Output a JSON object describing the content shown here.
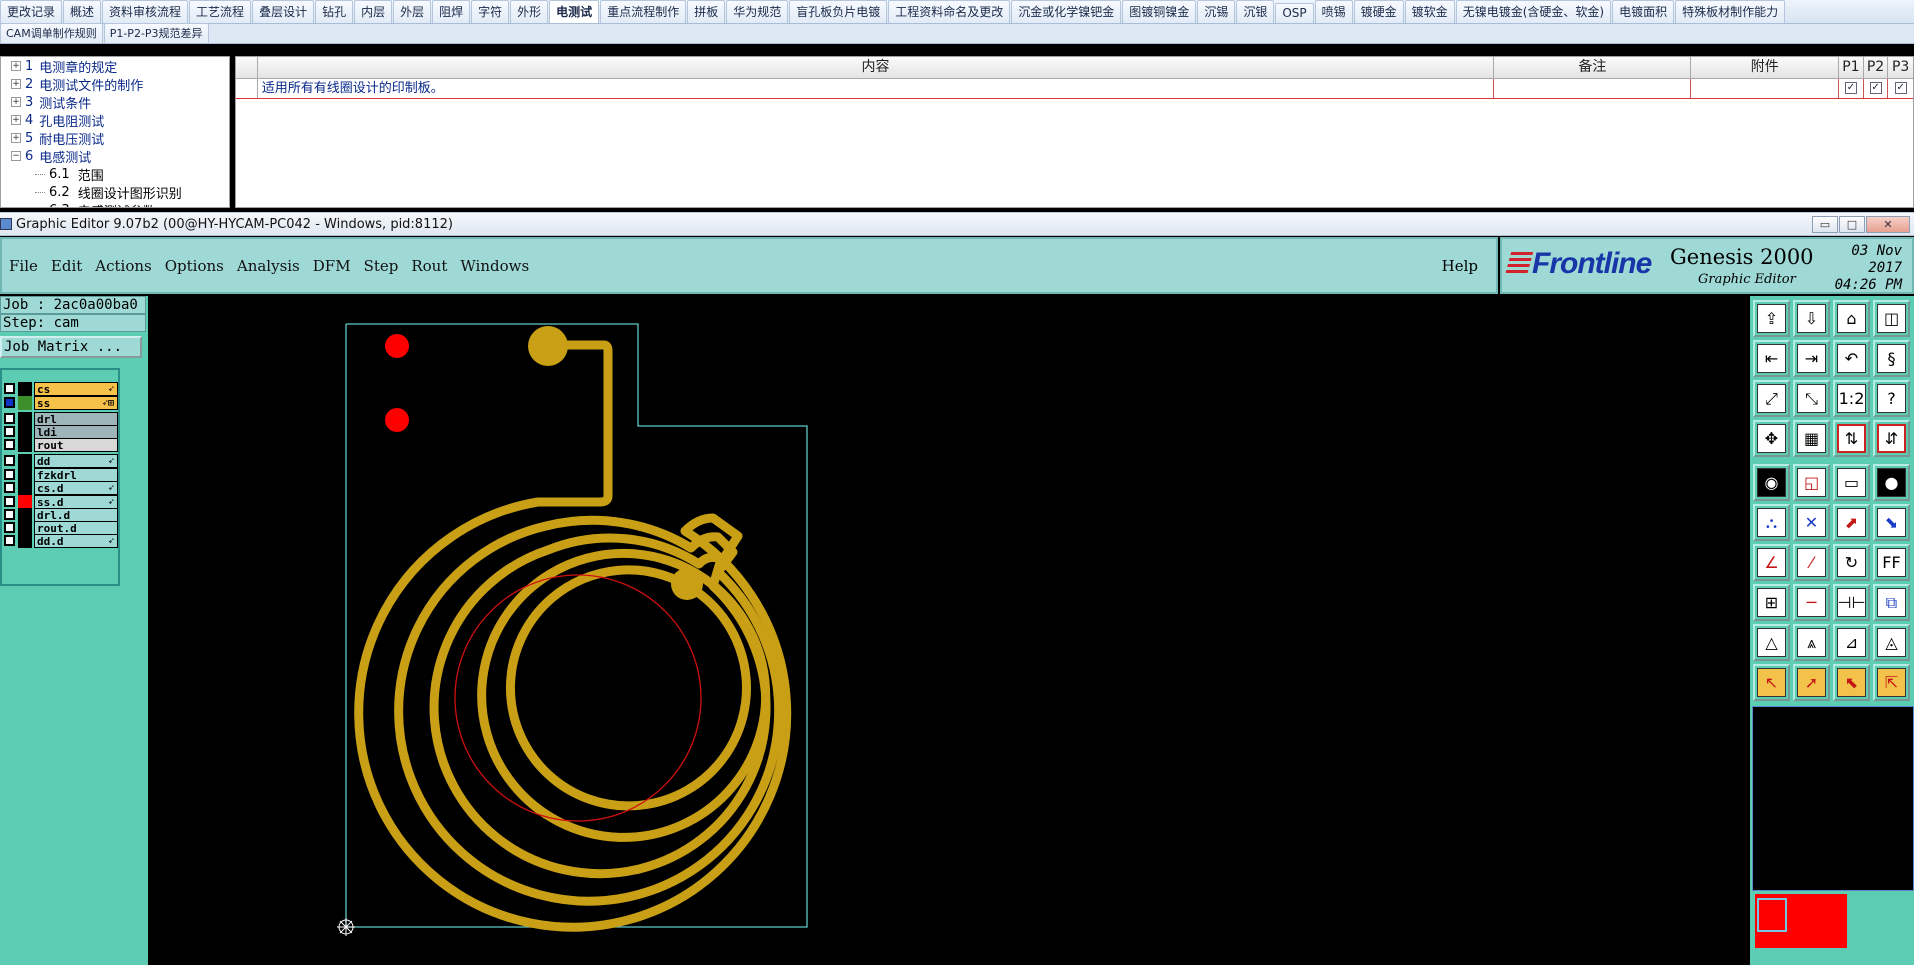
{
  "top_app": {
    "tabs_row1": [
      "更改记录",
      "概述",
      "资料审核流程",
      "工艺流程",
      "叠层设计",
      "钻孔",
      "内层",
      "外层",
      "阻焊",
      "字符",
      "外形",
      "电测试",
      "重点流程制作",
      "拼板",
      "华为规范",
      "盲孔板负片电镀",
      "工程资料命名及更改",
      "沉金或化学镍钯金",
      "图镀铜镍金",
      "沉锡",
      "沉银",
      "OSP",
      "喷锡",
      "镀硬金",
      "镀软金",
      "无镍电镀金(含硬金、软金)",
      "电镀面积",
      "特殊板材制作能力"
    ],
    "active_tab": "电测试",
    "tabs_row2": [
      "CAM调单制作规则",
      "P1-P2-P3规范差异"
    ],
    "tree": [
      {
        "num": "1",
        "label": "电测章的规定",
        "expand": "+"
      },
      {
        "num": "2",
        "label": "电测试文件的制作",
        "expand": "+"
      },
      {
        "num": "3",
        "label": "测试条件",
        "expand": "+"
      },
      {
        "num": "4",
        "label": "孔电阻测试",
        "expand": "+"
      },
      {
        "num": "5",
        "label": "耐电压测试",
        "expand": "+"
      },
      {
        "num": "6",
        "label": "电感测试",
        "expand": "−"
      }
    ],
    "tree_children": [
      {
        "num": "6.1",
        "label": "范围"
      },
      {
        "num": "6.2",
        "label": "线圈设计图形识别"
      },
      {
        "num": "6.3",
        "label": "电感测试参数"
      }
    ],
    "grid_headers": {
      "content": "内容",
      "remark": "备注",
      "attach": "附件",
      "p1": "P1",
      "p2": "P2",
      "p3": "P3"
    },
    "grid_row": {
      "content": "适用所有有线圈设计的印制板。",
      "remark": "",
      "attach": "",
      "p1": "✓",
      "p2": "✓",
      "p3": "✓"
    }
  },
  "genesis": {
    "window_title": "Graphic Editor 9.07b2 (00@HY-HYCAM-PC042 - Windows, pid:8112)",
    "window_buttons": {
      "min": "▭",
      "max": "□",
      "close": "✕"
    },
    "menu": [
      "File",
      "Edit",
      "Actions",
      "Options",
      "Analysis",
      "DFM",
      "Step",
      "Rout",
      "Windows"
    ],
    "help": "Help",
    "brand": {
      "logo": "Frontline",
      "product": "Genesis 2000",
      "subtitle": "Graphic Editor",
      "date_line1": "03 Nov 2017",
      "date_line2": "04:26 PM"
    },
    "job_line": "Job : 2ac0a00ba0",
    "step_line": "Step: cam",
    "job_matrix": "Job Matrix ...",
    "layers": [
      {
        "name": "cs",
        "swatch": "#000000",
        "bg": "#f7c24a",
        "flag": "➶"
      },
      {
        "name": "ss",
        "swatch": "#3c8f2a",
        "bg": "#f7c24a",
        "flag": "➶⊞"
      },
      {
        "name": "drl",
        "swatch": "#000000",
        "bg": "#9db4b8",
        "flag": ""
      },
      {
        "name": "ldi",
        "swatch": "#000000",
        "bg": "#9db4b8",
        "flag": ""
      },
      {
        "name": "rout",
        "swatch": "#000000",
        "bg": "#d8d8d8",
        "flag": ""
      },
      {
        "name": "dd",
        "swatch": "#000000",
        "bg": "#9ed9d6",
        "flag": "➶"
      },
      {
        "name": "fzkdrl",
        "swatch": "#000000",
        "bg": "#9ed9d6",
        "flag": ""
      },
      {
        "name": "cs.d",
        "swatch": "#000000",
        "bg": "#9ed9d6",
        "flag": "➶"
      },
      {
        "name": "ss.d",
        "swatch": "#ff0000",
        "bg": "#9ed9d6",
        "flag": "➶"
      },
      {
        "name": "drl.d",
        "swatch": "#000000",
        "bg": "#9ed9d6",
        "flag": ""
      },
      {
        "name": "rout.d",
        "swatch": "#000000",
        "bg": "#9ed9d6",
        "flag": ""
      },
      {
        "name": "dd.d",
        "swatch": "#000000",
        "bg": "#9ed9d6",
        "flag": "➶"
      }
    ],
    "toolbar_icons": [
      "save-to-layer-icon",
      "save-from-layer-icon",
      "home-icon",
      "window-split-icon",
      "move-left-icon",
      "move-right-icon",
      "undo-icon",
      "redo-s-icon",
      "zoom-fit-icon",
      "zoom-center-icon",
      "scale-1-2-icon",
      "help-query-icon",
      "pan-tool-icon",
      "grid-icon",
      "snap-red-icon",
      "snap-red-2-icon",
      "camera-icon",
      "measure-diag-icon",
      "ruler-icon",
      "dot-pad-icon",
      "connect-nodes-icon",
      "cross-cancel-icon",
      "line-red-icon",
      "line-blue-icon",
      "angle-red-icon",
      "slash-red-icon",
      "arc-return-icon",
      "ff-text-icon",
      "select-node-icon",
      "minus-line-icon",
      "dimension-icon",
      "group-icon",
      "triangle-a-icon",
      "triangle-b-icon",
      "triangle-c-icon",
      "triangle-d-icon",
      "pointer-icon",
      "pointer-red-icon",
      "pointer-select-icon",
      "pointer-multi-icon"
    ],
    "toolbar_glyphs": [
      "⇪",
      "⇩",
      "⌂",
      "◫",
      "⇤",
      "⇥",
      "↶",
      "§",
      "⤢",
      "⤡",
      "1:2",
      "?",
      "✥",
      "▦",
      "⇅",
      "⇵",
      "◉",
      "◱",
      "▭",
      "●",
      "⛬",
      "✕",
      "⬈",
      "⬊",
      "∠",
      "⁄",
      "↻",
      "FF",
      "⊞",
      "─",
      "⊣⊢",
      "⧉",
      "△",
      "⩓",
      "⊿",
      "◬",
      "↖",
      "➚",
      "⬉",
      "⇱"
    ],
    "colors": {
      "copper": "#c9a015",
      "pad_red": "#ff0000",
      "outline": "#5fc9c9",
      "inner_circle": "#d01010",
      "panel": "#5ccdb3",
      "menu_bg": "#9ed9d6"
    }
  }
}
